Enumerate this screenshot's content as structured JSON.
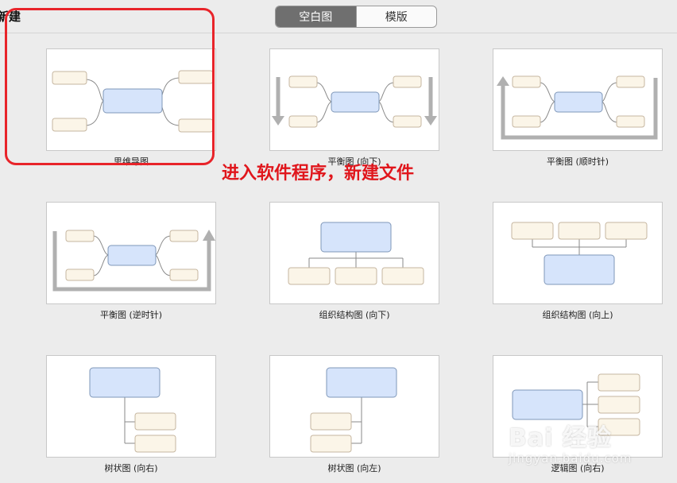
{
  "window": {
    "title": "新建"
  },
  "segmented": {
    "tabs": [
      "空白图",
      "模版"
    ],
    "active_index": 0
  },
  "templates": [
    {
      "label": "思维导图"
    },
    {
      "label": "平衡图 (向下)"
    },
    {
      "label": "平衡图 (顺时针)"
    },
    {
      "label": "平衡图 (逆时针)"
    },
    {
      "label": "组织结构图 (向下)"
    },
    {
      "label": "组织结构图 (向上)"
    },
    {
      "label": "树状图 (向右)"
    },
    {
      "label": "树状图 (向左)"
    },
    {
      "label": "逻辑图 (向右)"
    }
  ],
  "annotation": {
    "text": "进入软件程序，新建文件"
  },
  "watermark": {
    "main": "Bai 经验",
    "sub": "jingyan.baidu.com"
  },
  "colors": {
    "central_fill": "#d6e4fb",
    "central_stroke": "#7f97b8",
    "topic_fill": "#fbf5e8",
    "topic_stroke": "#c6b6a0",
    "connector": "#8a8a8a",
    "arrow": "#b0b0b0",
    "highlight": "#e8242a"
  }
}
